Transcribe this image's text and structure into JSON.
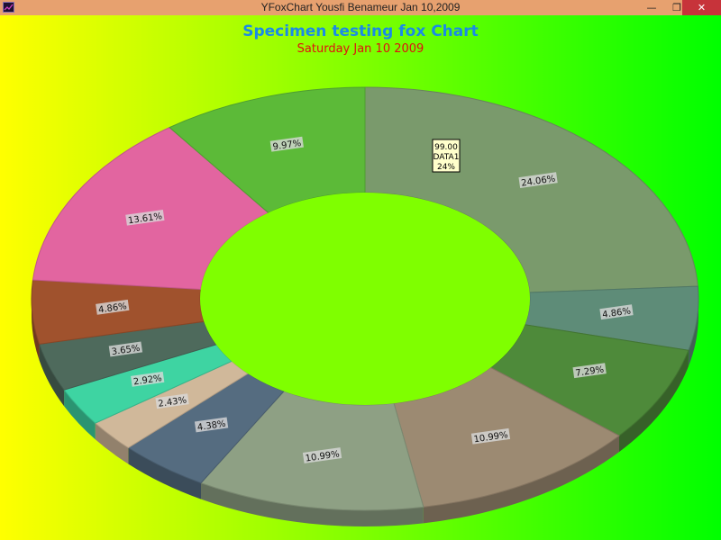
{
  "window": {
    "title": "YFoxChart   Yousfi  Benameur Jan 10,2009",
    "minimize_glyph": "—",
    "maximize_glyph": "❐",
    "close_glyph": "✕"
  },
  "chart_data": {
    "type": "pie",
    "variant": "3d-donut",
    "title": "Specimen testing fox Chart",
    "subtitle": "Saturday Jan 10 2009",
    "title_color": "#1a8ae6",
    "subtitle_color": "#e01010",
    "background": {
      "left": "#ffff00",
      "right": "#00ff00",
      "hole": "#7fff00"
    },
    "slices": [
      {
        "label": "24.06%",
        "value": 24.06,
        "color": "#7a9a6c"
      },
      {
        "label": "4.86%",
        "value": 4.86,
        "color": "#5e8c78"
      },
      {
        "label": "7.29%",
        "value": 7.29,
        "color": "#4e8a3a"
      },
      {
        "label": "10.99%",
        "value": 10.99,
        "color": "#9c8a72"
      },
      {
        "label": "10.99%",
        "value": 10.99,
        "color": "#8ea084"
      },
      {
        "label": "4.38%",
        "value": 4.38,
        "color": "#556c80"
      },
      {
        "label": "2.43%",
        "value": 2.43,
        "color": "#d0b89a"
      },
      {
        "label": "2.92%",
        "value": 2.92,
        "color": "#3ed4a2"
      },
      {
        "label": "3.65%",
        "value": 3.65,
        "color": "#4e6a5c"
      },
      {
        "label": "4.86%",
        "value": 4.86,
        "color": "#a0522d"
      },
      {
        "label": "13.61%",
        "value": 13.61,
        "color": "#e265a0"
      },
      {
        "label": "9.97%",
        "value": 9.97,
        "color": "#5cba38"
      }
    ],
    "tooltip": {
      "lines": [
        "99.00",
        "DATA1",
        "24%"
      ]
    }
  }
}
